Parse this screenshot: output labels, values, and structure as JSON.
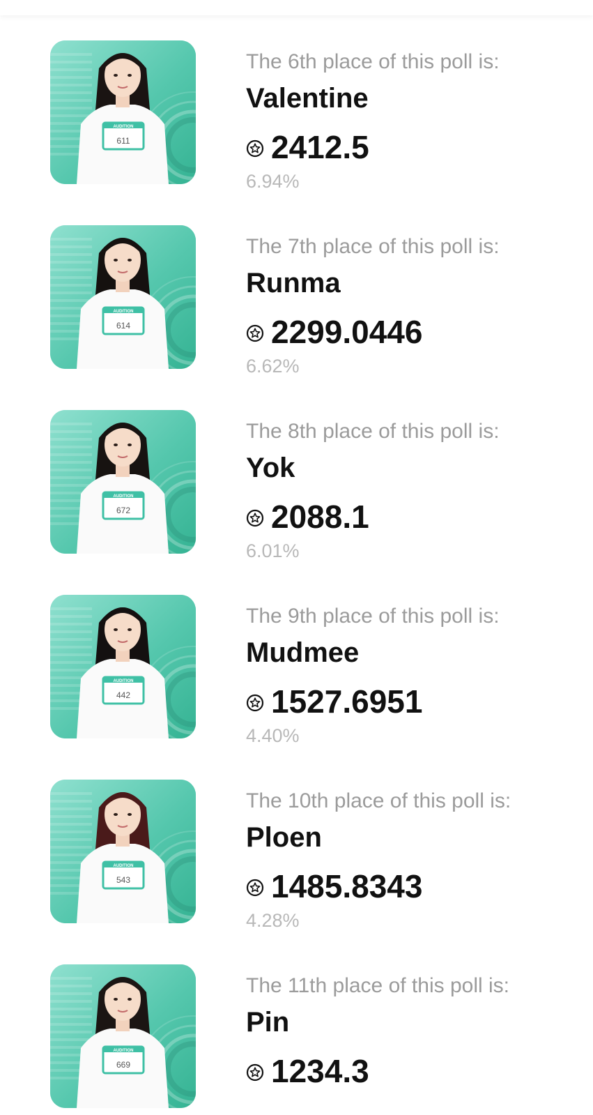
{
  "entries": [
    {
      "place_text": "The 6th place of this poll is:",
      "name": "Valentine",
      "score": "2412.5",
      "percent": "6.94%",
      "hair": "#1a1412",
      "badge": "611"
    },
    {
      "place_text": "The 7th place of this poll is:",
      "name": "Runma",
      "score": "2299.0446",
      "percent": "6.62%",
      "hair": "#15110f",
      "badge": "614"
    },
    {
      "place_text": "The 8th place of this poll is:",
      "name": "Yok",
      "score": "2088.1",
      "percent": "6.01%",
      "hair": "#171311",
      "badge": "672"
    },
    {
      "place_text": "The 9th place of this poll is:",
      "name": "Mudmee",
      "score": "1527.6951",
      "percent": "4.40%",
      "hair": "#141010",
      "badge": "442"
    },
    {
      "place_text": "The 10th place of this poll is:",
      "name": "Ploen",
      "score": "1485.8343",
      "percent": "4.28%",
      "hair": "#4a1a1a",
      "badge": "543"
    },
    {
      "place_text": "The 11th place of this poll is:",
      "name": "Pin",
      "score": "1234.3",
      "percent": "",
      "hair": "#1b1513",
      "badge": "669"
    }
  ],
  "colors": {
    "photo_bg": "#4fc6ab",
    "text_primary": "#111111",
    "text_secondary": "#9b9b9b",
    "text_tertiary": "#b8b8b8"
  },
  "icons": {
    "score": "star-in-circle-icon"
  }
}
